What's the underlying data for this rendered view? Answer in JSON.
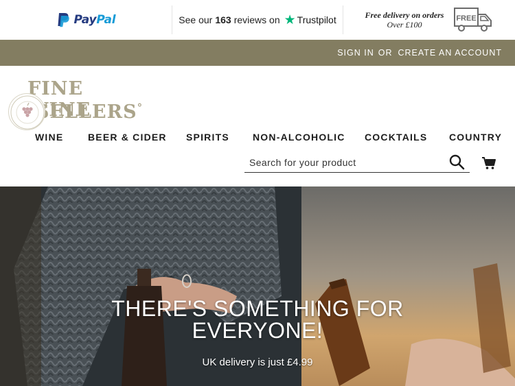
{
  "trust_bar": {
    "paypal": {
      "pay": "Pay",
      "pal": "Pal",
      "icon": "paypal-icon"
    },
    "trustpilot": {
      "prefix": "See our",
      "count": "163",
      "suffix": "reviews on",
      "brand": "Trustpilot",
      "icon": "trustpilot-star-icon"
    },
    "delivery": {
      "line1": "Free delivery on orders",
      "line2": "Over £100",
      "truck_label": "FREE",
      "icon": "delivery-truck-icon"
    }
  },
  "account_bar": {
    "sign_in": "SIGN IN",
    "or": "OR",
    "create_account": "CREATE AN ACCOUNT"
  },
  "logo": {
    "line1": "FINE WINE",
    "line2": "SELLERS",
    "line2_suffix": "°"
  },
  "nav": {
    "items": [
      {
        "label": "WINE"
      },
      {
        "label": "BEER & CIDER"
      },
      {
        "label": "SPIRITS"
      },
      {
        "label": "NON-ALCOHOLIC"
      },
      {
        "label": "COCKTAILS"
      },
      {
        "label": "COUNTRY"
      }
    ]
  },
  "search": {
    "placeholder": "Search for your product",
    "value": ""
  },
  "hero": {
    "title_line1": "THERE'S SOMETHING FOR",
    "title_line2": "EVERYONE!",
    "subtitle": "UK delivery is just £4.99"
  },
  "colors": {
    "account_bar": "#837d61",
    "logo": "#aba48a",
    "paypal_dark": "#253b80",
    "paypal_light": "#179bd7",
    "trustpilot_green": "#00b67a"
  }
}
